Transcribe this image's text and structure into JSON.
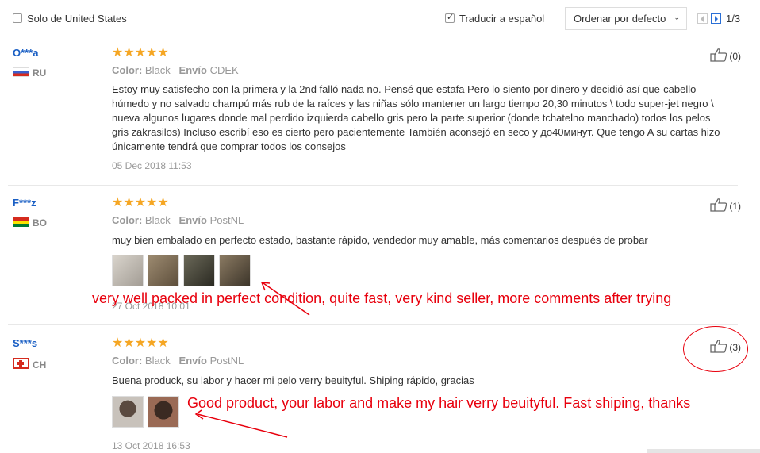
{
  "filters": {
    "only_us": "Solo de United States",
    "only_us_checked": false,
    "translate": "Traducir a español",
    "translate_checked": true,
    "sort": "Ordenar por defecto",
    "pagination": "1/3"
  },
  "reviews": [
    {
      "user": "O***a",
      "country": "RU",
      "flag": "ru",
      "stars": "★★★★★",
      "color_label": "Color:",
      "color": "Black",
      "shipping_label": "Envío",
      "shipping": "CDEK",
      "text": "Estoy muy satisfecho con la primera y la 2nd falló nada no. Pensé que estafa Pero lo siento por dinero y decidió así que-cabello húmedo y no salvado champú más rub de la raíces y las niñas sólo mantener un largo tiempo 20,30 minutos \\ todo super-jet negro \\ nueva algunos lugares donde mal perdido izquierda cabello gris pero la parte superior (donde tchatelno manchado) todos los pelos gris zakrasilos) Incluso escribí eso es cierto pero pacientemente También aconsejó en seco y до40минут. Que tengo A su cartas hizo únicamente tendrá que comprar todos los consejos",
      "date": "05 Dec 2018 11:53",
      "helpful": "(0)"
    },
    {
      "user": "F***z",
      "country": "BO",
      "flag": "bo",
      "stars": "★★★★★",
      "color_label": "Color:",
      "color": "Black",
      "shipping_label": "Envío",
      "shipping": "PostNL",
      "text": "muy bien embalado en perfecto estado, bastante rápido, vendedor muy amable, más comentarios después de probar",
      "date": "27 Oct 2018 10:01",
      "helpful": "(1)",
      "photos": [
        "#c9c4bd",
        "#8a7a64",
        "#4b4a3c",
        "#6b5d4a"
      ]
    },
    {
      "user": "S***s",
      "country": "CH",
      "flag": "ch",
      "stars": "★★★★★",
      "color_label": "Color:",
      "color": "Black",
      "shipping_label": "Envío",
      "shipping": "PostNL",
      "text": "Buena produck, su labor y hacer mi pelo verry beuityful. Shiping rápido, gracias",
      "date": "13 Oct 2018 16:53",
      "helpful": "(3)",
      "photos": [
        "#a8a29b",
        "#7a5444"
      ]
    }
  ],
  "annotations": {
    "translation_1": "very well packed in perfect condition, quite fast, very kind seller, more comments after trying",
    "translation_2": "Good product, your labor and make my hair verry beuityful. Fast shiping, thanks",
    "color": "#e8000d"
  },
  "icons": {
    "thumb": "thumbs-up-icon",
    "star": "star-icon",
    "checkbox": "checkbox-icon",
    "chevron": "chevron-down-icon"
  }
}
